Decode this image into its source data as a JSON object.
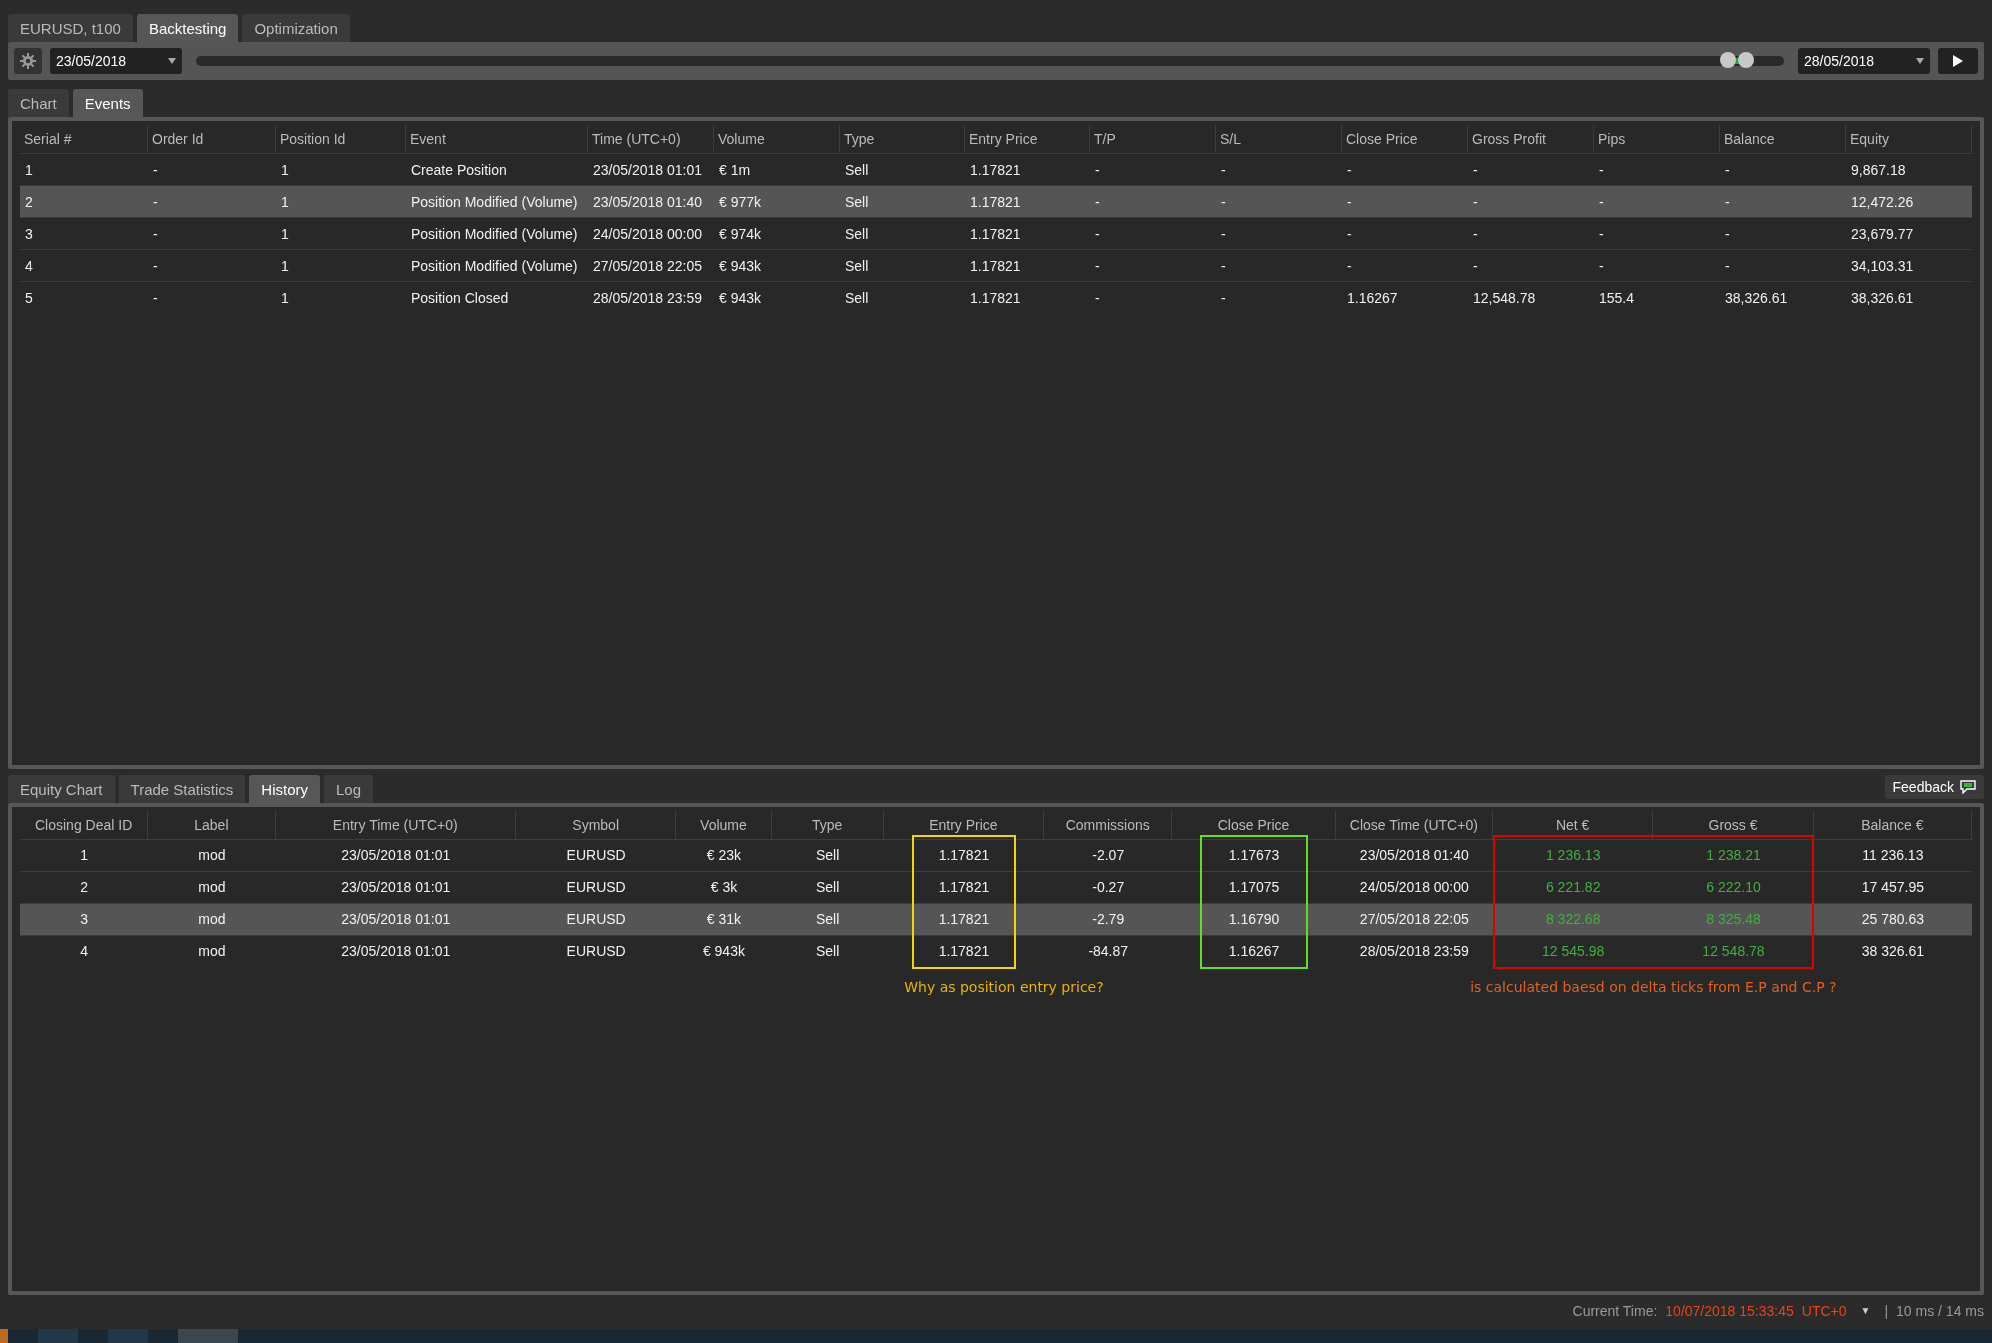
{
  "top_tabs": [
    {
      "label": "EURUSD, t100",
      "selected": false
    },
    {
      "label": "Backtesting",
      "selected": true
    },
    {
      "label": "Optimization",
      "selected": false
    }
  ],
  "toolbar": {
    "start_date": "23/05/2018",
    "end_date": "28/05/2018",
    "thumbs": [
      {
        "level": 0.965
      },
      {
        "level": 0.976
      }
    ]
  },
  "upper_tabs": [
    {
      "label": "Chart",
      "selected": false
    },
    {
      "label": "Events",
      "selected": true
    }
  ],
  "events_table": {
    "columns": [
      "Serial #",
      "Order Id",
      "Position Id",
      "Event",
      "Time (UTC+0)",
      "Volume",
      "Type",
      "Entry Price",
      "T/P",
      "S/L",
      "Close Price",
      "Gross Profit",
      "Pips",
      "Balance",
      "Equity"
    ],
    "rows": [
      {
        "selected": false,
        "cells": [
          "1",
          "-",
          "1",
          "Create Position",
          "23/05/2018 01:01",
          "€ 1m",
          "Sell",
          "1.17821",
          "-",
          "-",
          "-",
          "-",
          "-",
          "-",
          "9,867.18"
        ]
      },
      {
        "selected": true,
        "cells": [
          "2",
          "-",
          "1",
          "Position Modified (Volume)",
          "23/05/2018 01:40",
          "€ 977k",
          "Sell",
          "1.17821",
          "-",
          "-",
          "-",
          "-",
          "-",
          "-",
          "12,472.26"
        ]
      },
      {
        "selected": false,
        "cells": [
          "3",
          "-",
          "1",
          "Position Modified (Volume)",
          "24/05/2018 00:00",
          "€ 974k",
          "Sell",
          "1.17821",
          "-",
          "-",
          "-",
          "-",
          "-",
          "-",
          "23,679.77"
        ]
      },
      {
        "selected": false,
        "cells": [
          "4",
          "-",
          "1",
          "Position Modified (Volume)",
          "27/05/2018 22:05",
          "€ 943k",
          "Sell",
          "1.17821",
          "-",
          "-",
          "-",
          "-",
          "-",
          "-",
          "34,103.31"
        ]
      },
      {
        "selected": false,
        "cells": [
          "5",
          "-",
          "1",
          "Position Closed",
          "28/05/2018 23:59",
          "€ 943k",
          "Sell",
          "1.17821",
          "-",
          "-",
          "1.16267",
          "12,548.78",
          "155.4",
          "38,326.61",
          "38,326.61"
        ]
      }
    ]
  },
  "lower_tabs": [
    {
      "label": "Equity Chart",
      "selected": false
    },
    {
      "label": "Trade Statistics",
      "selected": false
    },
    {
      "label": "History",
      "selected": true
    },
    {
      "label": "Log",
      "selected": false
    }
  ],
  "feedback_button": "Feedback",
  "history_table": {
    "columns": [
      {
        "label": "Closing Deal ID"
      },
      {
        "label": "Label"
      },
      {
        "label": "Entry Time (UTC+0)"
      },
      {
        "label": "Symbol"
      },
      {
        "label": "Volume"
      },
      {
        "label": "Type"
      },
      {
        "label": "Entry Price",
        "frame": {
          "color": "#f2d600"
        }
      },
      {
        "label": "Commissions"
      },
      {
        "label": "Close Price",
        "frame": {
          "color": "#5fe020"
        }
      },
      {
        "label": "Close Time (UTC+0)"
      },
      {
        "label": "Net €",
        "color": "#3fb03f",
        "frame": {
          "color": "#e00000"
        }
      },
      {
        "label": "Gross €",
        "color": "#3fb03f",
        "frame": {
          "color": "#e00000"
        }
      },
      {
        "label": "Balance €"
      }
    ],
    "rows": [
      {
        "selected": false,
        "cells": [
          "1",
          "mod",
          "23/05/2018 01:01",
          "EURUSD",
          "€ 23k",
          "Sell",
          "1.17821",
          "-2.07",
          "1.17673",
          "23/05/2018 01:40",
          "1 236.13",
          "1 238.21",
          "11 236.13"
        ]
      },
      {
        "selected": false,
        "cells": [
          "2",
          "mod",
          "23/05/2018 01:01",
          "EURUSD",
          "€ 3k",
          "Sell",
          "1.17821",
          "-0.27",
          "1.17075",
          "24/05/2018 00:00",
          "6 221.82",
          "6 222.10",
          "17 457.95"
        ]
      },
      {
        "selected": true,
        "cells": [
          "3",
          "mod",
          "23/05/2018 01:01",
          "EURUSD",
          "€ 31k",
          "Sell",
          "1.17821",
          "-2.79",
          "1.16790",
          "27/05/2018 22:05",
          "8 322.68",
          "8 325.48",
          "25 780.63"
        ]
      },
      {
        "selected": false,
        "cells": [
          "4",
          "mod",
          "23/05/2018 01:01",
          "EURUSD",
          "€ 943k",
          "Sell",
          "1.17821",
          "-84.87",
          "1.16267",
          "28/05/2018 23:59",
          "12 545.98",
          "12 548.78",
          "38 326.61"
        ]
      }
    ],
    "annotations": [
      {
        "text": "Why as position entry price?",
        "color": "#e8b400"
      },
      {
        "text": "is calculated baesd on delta ticks from E.P and C.P ?",
        "color": "#e2601c"
      }
    ]
  },
  "status_bar": {
    "label": "Current Time:",
    "time": "10/07/2018 15:33:45",
    "timezone": "UTC+0",
    "dropdown": "▼",
    "separator": "|",
    "timing": "10 ms / 14 ms"
  }
}
